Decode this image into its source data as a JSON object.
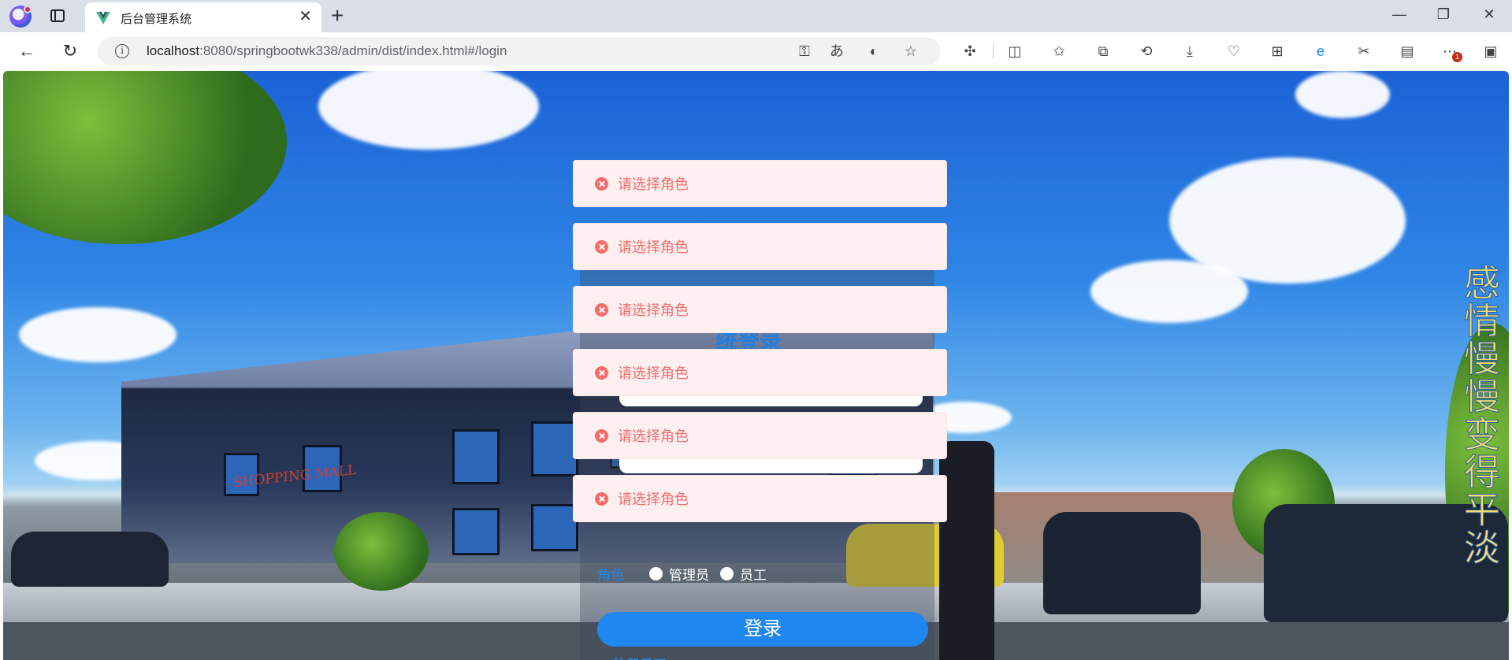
{
  "browser": {
    "tab_title": "后台管理系统",
    "url_host": "localhost",
    "url_path": ":8080/springbootwk338/admin/dist/index.html#/login",
    "notification_badge": "1"
  },
  "page": {
    "vertical_title": "感情慢慢变得平淡",
    "login_title": "统登录",
    "role_label": "角色",
    "role_options": [
      "管理员",
      "员工"
    ],
    "login_button": "登录",
    "register_link": "注册员工"
  },
  "messages": [
    {
      "text": "请选择角色",
      "type": "error"
    },
    {
      "text": "请选择角色",
      "type": "error"
    },
    {
      "text": "请选择角色",
      "type": "error"
    },
    {
      "text": "请选择角色",
      "type": "error"
    },
    {
      "text": "请选择角色",
      "type": "error"
    },
    {
      "text": "请选择角色",
      "type": "error"
    }
  ],
  "colors": {
    "accent": "#1e88f0",
    "error_text": "#f56c6c",
    "error_bg": "#fef0f0",
    "vertical_text": "#f3e06b"
  }
}
